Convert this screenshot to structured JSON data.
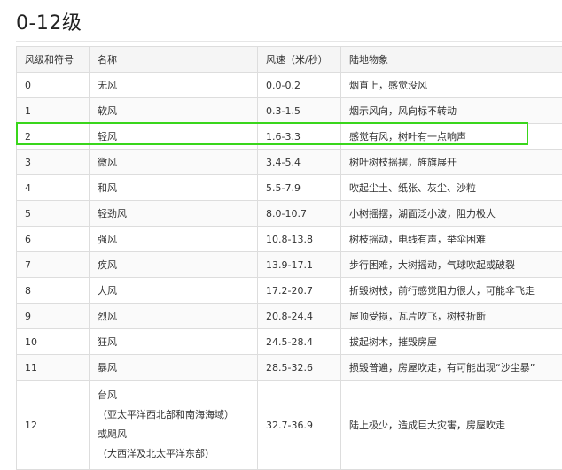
{
  "page": {
    "title": "0-12级"
  },
  "table": {
    "headers": [
      "风级和符号",
      "名称",
      "风速（米/秒）",
      "陆地物象"
    ],
    "rows": [
      {
        "level": "0",
        "name": "无风",
        "speed": "0.0-0.2",
        "description": "烟直上，感觉没风"
      },
      {
        "level": "1",
        "name": "软风",
        "speed": "0.3-1.5",
        "description": "烟示风向，风向标不转动"
      },
      {
        "level": "2",
        "name": "轻风",
        "speed": "1.6-3.3",
        "description": "感觉有风，树叶有一点响声"
      },
      {
        "level": "3",
        "name": "微风",
        "speed": "3.4-5.4",
        "description": "树叶树枝摇摆，旌旗展开"
      },
      {
        "level": "4",
        "name": "和风",
        "speed": "5.5-7.9",
        "description": "吹起尘土、纸张、灰尘、沙粒"
      },
      {
        "level": "5",
        "name": "轻劲风",
        "speed": "8.0-10.7",
        "description": "小树摇摆，湖面泛小波，阻力极大"
      },
      {
        "level": "6",
        "name": "强风",
        "speed": "10.8-13.8",
        "description": "树枝摇动，电线有声，举伞困难"
      },
      {
        "level": "7",
        "name": "疾风",
        "speed": "13.9-17.1",
        "description": "步行困难，大树摇动，气球吹起或破裂"
      },
      {
        "level": "8",
        "name": "大风",
        "speed": "17.2-20.7",
        "description": "折毁树枝，前行感觉阻力很大，可能伞飞走"
      },
      {
        "level": "9",
        "name": "烈风",
        "speed": "20.8-24.4",
        "description": "屋顶受损，瓦片吹飞，树枝折断"
      },
      {
        "level": "10",
        "name": "狂风",
        "speed": "24.5-28.4",
        "description": "拔起树木，摧毁房屋"
      },
      {
        "level": "11",
        "name": "暴风",
        "speed": "28.5-32.6",
        "description": "损毁普遍，房屋吹走，有可能出现“沙尘暴”"
      }
    ],
    "last_row": {
      "level": "12",
      "name_lines": [
        "台风",
        "（亚太平洋西北部和南海海域）",
        "或飓风",
        "（大西洋及北太平洋东部）"
      ],
      "speed": "32.7-36.9",
      "description": "陆上极少，造成巨大灾害，房屋吹走"
    }
  },
  "colors": {
    "highlight": "#39d61b",
    "header_bg": "#f5f5f5",
    "border": "#dddddd"
  }
}
